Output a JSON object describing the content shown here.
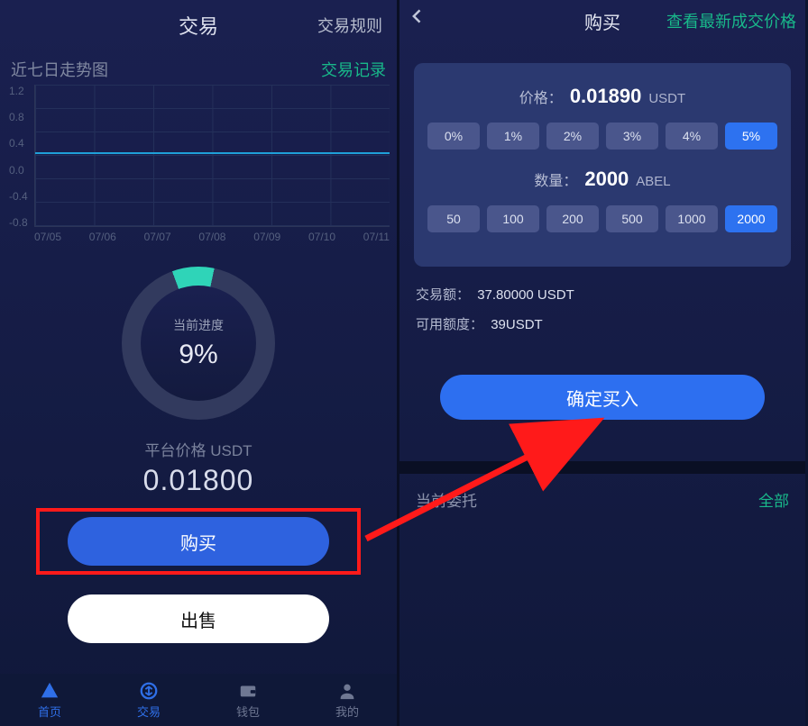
{
  "left": {
    "title": "交易",
    "rules_link": "交易规则",
    "chart_title_label": "近七日走势图",
    "records_link": "交易记录",
    "progress_label": "当前进度",
    "progress_pct": "9%",
    "price_label": "平台价格 USDT",
    "price_value": "0.01800",
    "buy_button": "购买",
    "sell_button": "出售",
    "nav": {
      "home": "首页",
      "trade": "交易",
      "wallet": "钱包",
      "mine": "我的"
    }
  },
  "right": {
    "title": "购买",
    "latest_link": "查看最新成交价格",
    "price_label": "价格：",
    "price_value": "0.01890",
    "price_unit": "USDT",
    "percent_options": [
      "0%",
      "1%",
      "2%",
      "3%",
      "4%",
      "5%"
    ],
    "percent_selected": "5%",
    "qty_label": "数量：",
    "qty_value": "2000",
    "qty_unit": "ABEL",
    "qty_options": [
      "50",
      "100",
      "200",
      "500",
      "1000",
      "2000"
    ],
    "qty_selected": "2000",
    "amount_label": "交易额：",
    "amount_value": "37.80000 USDT",
    "limit_label": "可用额度：",
    "limit_value": "39USDT",
    "confirm_button": "确定买入",
    "orders_title": "当前委托",
    "orders_all": "全部"
  },
  "chart_data": {
    "type": "line",
    "title": "近七日走势图",
    "xlabel": "",
    "ylabel": "",
    "ylim": [
      -0.8,
      1.2
    ],
    "y_ticks": [
      "1.2",
      "0.8",
      "0.4",
      "0.0",
      "-0.4",
      "-0.8"
    ],
    "x_ticks": [
      "07/05",
      "07/06",
      "07/07",
      "07/08",
      "07/09",
      "07/10",
      "07/11"
    ],
    "series": [
      {
        "name": "price",
        "x": [
          "07/05",
          "07/06",
          "07/07",
          "07/08",
          "07/09",
          "07/10",
          "07/11"
        ],
        "values": [
          0.018,
          0.018,
          0.018,
          0.018,
          0.018,
          0.018,
          0.018
        ]
      }
    ]
  }
}
